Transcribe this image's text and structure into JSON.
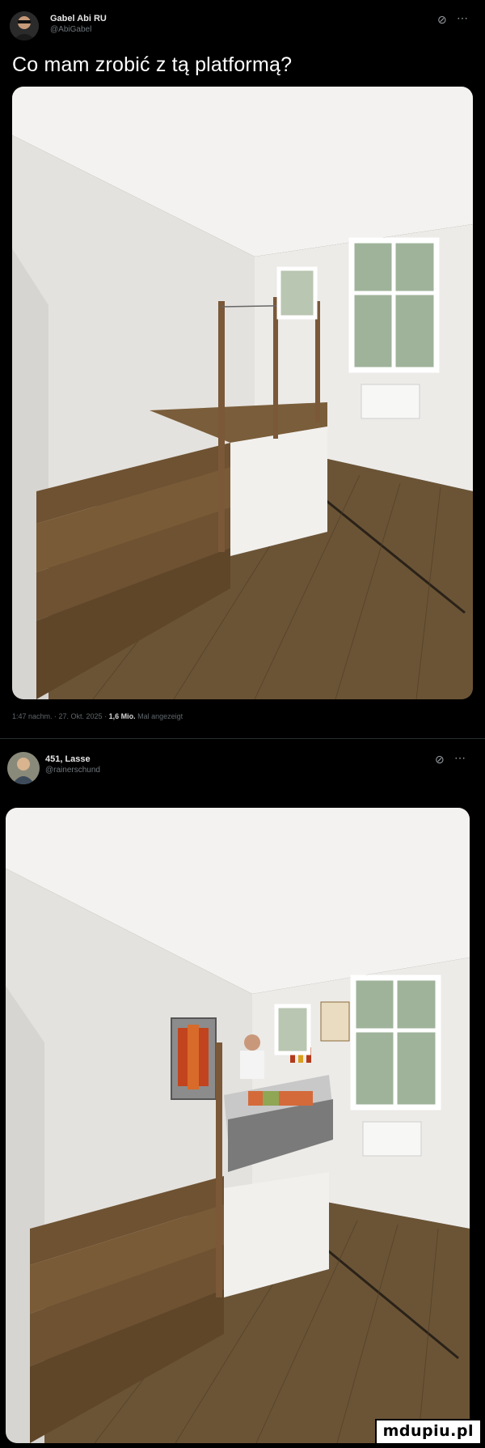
{
  "post1": {
    "author_name": "Gabel Abi RU",
    "handle": "@AbiGabel",
    "text": "Co mam zrobić z tą platformą?",
    "meta_time": "1:47 nachm. · 27. Okt. 2025 ·",
    "views": "1,6 Mio.",
    "views_suffix": "Mal angezeigt",
    "grok_icon": "⊘",
    "more_icon": "⋯"
  },
  "post2": {
    "author_name": "451, Lasse",
    "handle": "@rainerschund",
    "grok_icon": "⊘",
    "more_icon": "⋯"
  },
  "watermark": "mdupiu.pl",
  "colors": {
    "background": "#000000",
    "text": "#ffffff",
    "muted": "#6f767b",
    "wood": "#6b5436",
    "wall": "#eceae6"
  }
}
